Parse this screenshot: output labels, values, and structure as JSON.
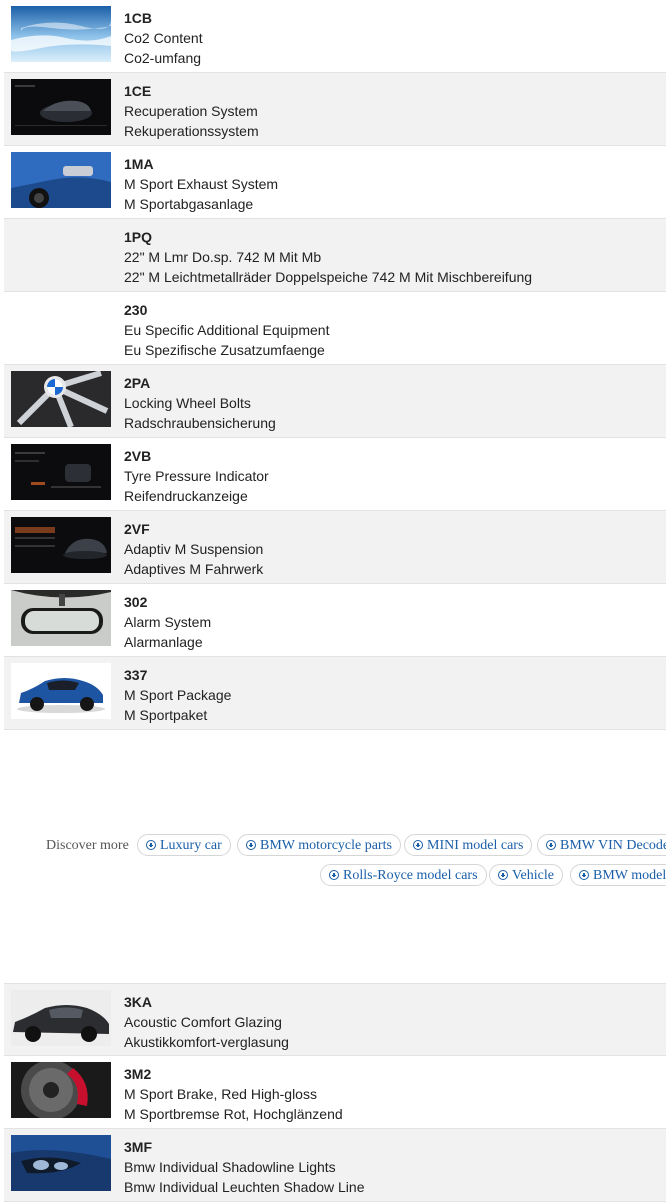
{
  "options_a": [
    {
      "code": "1CB",
      "en": "Co2 Content",
      "de": "Co2-umfang",
      "image": "sky-clouds-image"
    },
    {
      "code": "1CE",
      "en": "Recuperation System",
      "de": "Rekuperationssystem",
      "image": "idrive-screen-car-image"
    },
    {
      "code": "1MA",
      "en": "M Sport Exhaust System",
      "de": "M Sportabgasanlage",
      "image": "exhaust-rear-image"
    },
    {
      "code": "1PQ",
      "en": "22\" M Lmr Do.sp. 742 M Mit Mb",
      "de": "22\" M Leichtmetallräder Doppelspeiche 742 M Mit Mischbereifung",
      "image": ""
    },
    {
      "code": "230",
      "en": "Eu Specific Additional Equipment",
      "de": "Eu Spezifische Zusatzumfaenge",
      "image": ""
    },
    {
      "code": "2PA",
      "en": "Locking Wheel Bolts",
      "de": "Radschraubensicherung",
      "image": "wheel-hub-image"
    },
    {
      "code": "2VB",
      "en": "Tyre Pressure Indicator",
      "de": "Reifendruckanzeige",
      "image": "idrive-tyre-screen-image"
    },
    {
      "code": "2VF",
      "en": "Adaptiv M Suspension",
      "de": "Adaptives M Fahrwerk",
      "image": "idrive-suspension-screen-image"
    },
    {
      "code": "302",
      "en": "Alarm System",
      "de": "Alarmanlage",
      "image": "rear-view-mirror-image"
    },
    {
      "code": "337",
      "en": "M Sport Package",
      "de": "M Sportpaket",
      "image": "blue-suv-image"
    }
  ],
  "discover": {
    "label": "Discover more",
    "chips": [
      "Luxury car",
      "BMW motorcycle parts",
      "MINI model cars",
      "BMW VIN Decoder",
      "Rolls-Royce model cars",
      "Vehicle",
      "BMW model"
    ]
  },
  "options_b": [
    {
      "code": "3KA",
      "en": "Acoustic Comfort Glazing",
      "de": "Akustikkomfort-verglasung",
      "image": "dark-suv-side-image"
    },
    {
      "code": "3M2",
      "en": "M Sport Brake, Red High-gloss",
      "de": "M Sportbremse Rot, Hochglänzend",
      "image": "red-brake-caliper-image"
    },
    {
      "code": "3MF",
      "en": "Bmw Individual Shadowline Lights",
      "de": "Bmw Individual Leuchten Shadow Line",
      "image": "headlight-image"
    }
  ]
}
